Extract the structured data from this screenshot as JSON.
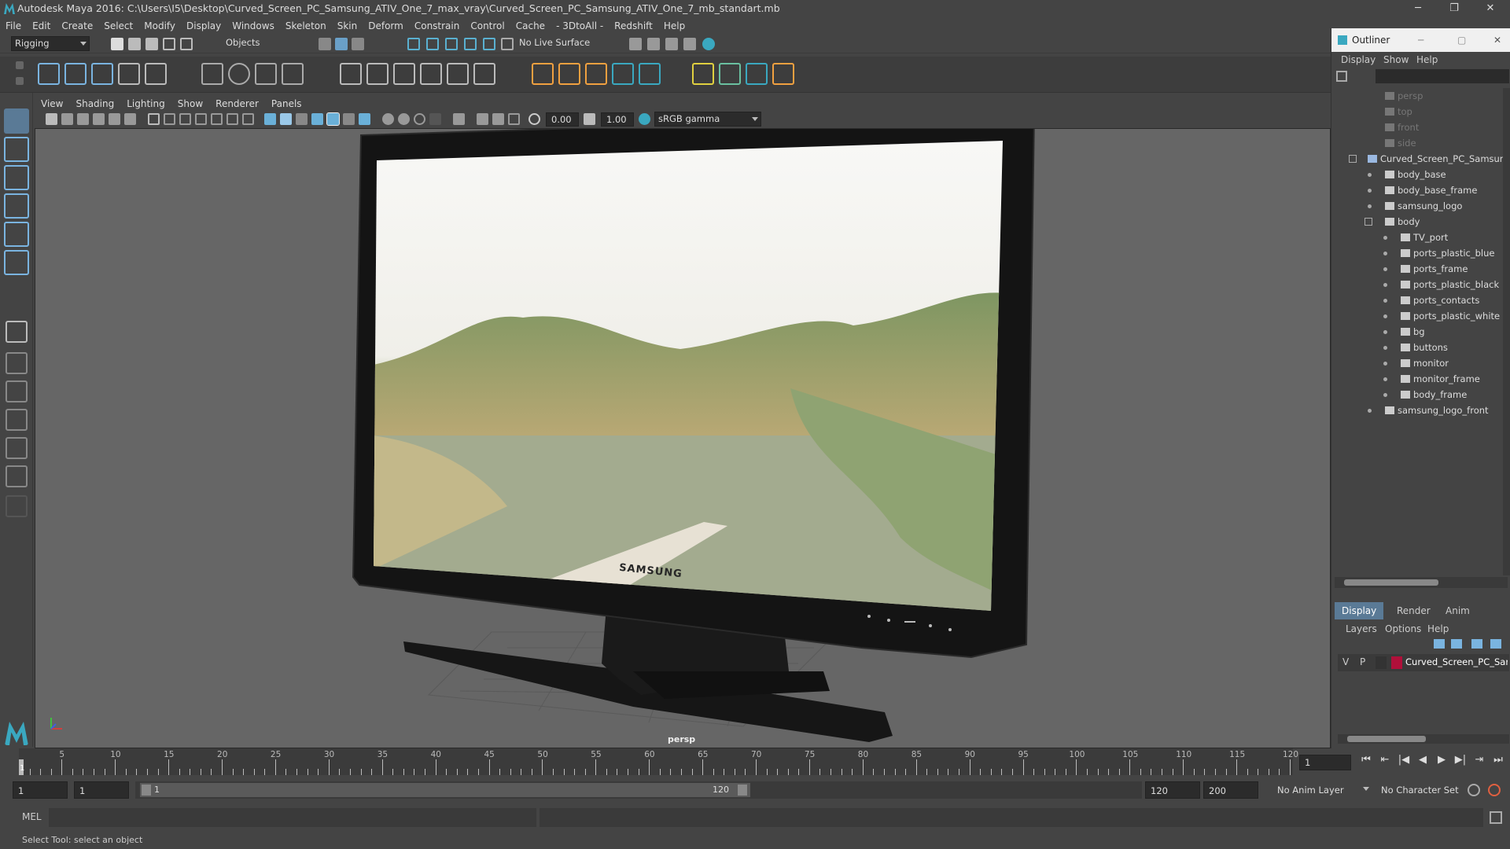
{
  "window": {
    "title": "Autodesk Maya 2016: C:\\Users\\I5\\Desktop\\Curved_Screen_PC_Samsung_ATIV_One_7_max_vray\\Curved_Screen_PC_Samsung_ATIV_One_7_mb_standart.mb",
    "minimize": "─",
    "maximize": "❐",
    "close": "✕"
  },
  "menubar": [
    "File",
    "Edit",
    "Create",
    "Select",
    "Modify",
    "Display",
    "Windows",
    "Skeleton",
    "Skin",
    "Deform",
    "Constrain",
    "Control",
    "Cache",
    "- 3DtoAll -",
    "Redshift",
    "Help"
  ],
  "statusline": {
    "mode": "Rigging",
    "selection_mask": "Objects",
    "live_surface": "No Live Surface"
  },
  "panel": {
    "menus": [
      "View",
      "Shading",
      "Lighting",
      "Show",
      "Renderer",
      "Panels"
    ],
    "field_a": "0.00",
    "field_b": "1.00",
    "color_space": "sRGB gamma",
    "camera_label": "persp",
    "brand_text": "SAMSUNG"
  },
  "outliner": {
    "title": "Outliner",
    "menus": [
      "Display",
      "Show",
      "Help"
    ],
    "items": [
      {
        "label": "persp",
        "dim": true
      },
      {
        "label": "top",
        "dim": true
      },
      {
        "label": "front",
        "dim": true
      },
      {
        "label": "side",
        "dim": true
      },
      {
        "label": "Curved_Screen_PC_Samsung_",
        "dim": false
      },
      {
        "label": "body_base",
        "dim": false
      },
      {
        "label": "body_base_frame",
        "dim": false
      },
      {
        "label": "samsung_logo",
        "dim": false
      },
      {
        "label": "body",
        "dim": false
      },
      {
        "label": "TV_port",
        "dim": false
      },
      {
        "label": "ports_plastic_blue",
        "dim": false
      },
      {
        "label": "ports_frame",
        "dim": false
      },
      {
        "label": "ports_plastic_black",
        "dim": false
      },
      {
        "label": "ports_contacts",
        "dim": false
      },
      {
        "label": "ports_plastic_white",
        "dim": false
      },
      {
        "label": "bg",
        "dim": false
      },
      {
        "label": "buttons",
        "dim": false
      },
      {
        "label": "monitor",
        "dim": false
      },
      {
        "label": "monitor_frame",
        "dim": false
      },
      {
        "label": "body_frame",
        "dim": false
      },
      {
        "label": "samsung_logo_front",
        "dim": false
      }
    ]
  },
  "layers": {
    "tabs": [
      "Display",
      "Render",
      "Anim"
    ],
    "menus": [
      "Layers",
      "Options",
      "Help"
    ],
    "row": {
      "v": "V",
      "p": "P",
      "name": "Curved_Screen_PC_Sar",
      "color": "#b0103a"
    }
  },
  "timeline": {
    "ticks": [
      "5",
      "10",
      "15",
      "20",
      "25",
      "30",
      "35",
      "40",
      "45",
      "50",
      "55",
      "60",
      "65",
      "70",
      "75",
      "80",
      "85",
      "90",
      "95",
      "100",
      "105",
      "110",
      "115",
      "120"
    ],
    "start_label": "1",
    "current_frame": "1"
  },
  "range": {
    "start": "1",
    "inner_start": "1",
    "slider_start": "1",
    "slider_end": "120",
    "end": "120",
    "anim_end": "200",
    "anim_layer": "No Anim Layer",
    "char_set": "No Character Set"
  },
  "cmdline": {
    "label": "MEL"
  },
  "helpline": {
    "text": "Select Tool: select an object"
  }
}
